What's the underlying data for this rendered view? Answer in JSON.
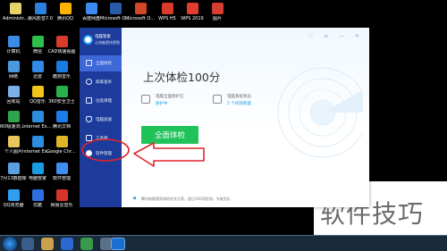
{
  "desktop": {
    "top_icons": [
      {
        "name": "admin-folder-icon",
        "label": "Administr...",
        "color": "#e8d36a"
      },
      {
        "name": "storm-video-icon",
        "label": "暴风影音7.0",
        "color": "#2b80e0"
      },
      {
        "name": "tencent-qq-icon",
        "label": "腾讯QQ",
        "color": "#ffb300"
      },
      {
        "name": "baofeng-icon",
        "label": "百度网盘",
        "color": "#3a8af0"
      },
      {
        "name": "office-word-icon",
        "label": "Microsoft Office Wo...",
        "color": "#2a5aa8"
      },
      {
        "name": "office-ppt-icon",
        "label": "Microsoft Office Po...",
        "color": "#d24726"
      },
      {
        "name": "wps-h5-icon",
        "label": "WPS H5",
        "color": "#d83a2b"
      },
      {
        "name": "wps-2019-icon",
        "label": "WPS 2019",
        "color": "#e23c2d"
      },
      {
        "name": "picture-icon",
        "label": "图片",
        "color": "#d63c2f"
      }
    ],
    "left_icons": [
      {
        "name": "computer-icon",
        "label": "计算机",
        "color": "#3c8be8"
      },
      {
        "name": "network-icon",
        "label": "网络",
        "color": "#4a9ae0"
      },
      {
        "name": "recycle-bin-icon",
        "label": "回收站",
        "color": "#7ab0e8"
      },
      {
        "name": "360-browser-icon",
        "label": "360极速浏览器",
        "color": "#2ea44f"
      },
      {
        "name": "personal-folder-icon",
        "label": "个人图片",
        "color": "#e8c65a"
      },
      {
        "name": "data-icon",
        "label": "7月13数据库",
        "color": "#5aa0e0"
      },
      {
        "name": "qq-browser-icon",
        "label": "QQ浏览器",
        "color": "#2e9ff0"
      }
    ],
    "second_icons": [
      {
        "name": "wechat-icon",
        "label": "微信",
        "color": "#2fbf4a"
      },
      {
        "name": "library-icon",
        "label": "迅雷",
        "color": "#2f8ae8"
      },
      {
        "name": "qq-music-icon",
        "label": "QQ音乐",
        "color": "#f3c51b"
      },
      {
        "name": "ie-icon",
        "label": "Internet Explorer",
        "color": "#2d8be0"
      },
      {
        "name": "ie2-icon",
        "label": "Internet Explorer",
        "color": "#2d8be0"
      },
      {
        "name": "pc-manager-icon",
        "label": "电脑管家",
        "color": "#1a9be6"
      },
      {
        "name": "mihoyo-icon",
        "label": "优酷",
        "color": "#2e6fe0"
      }
    ],
    "third_icons": [
      {
        "name": "cad-icon",
        "label": "CAD快速看图",
        "color": "#d83a2b"
      },
      {
        "name": "kugou-icon",
        "label": "酷狗音乐",
        "color": "#1a7be0"
      },
      {
        "name": "360-safe-icon",
        "label": "360安全卫士",
        "color": "#27b04c"
      },
      {
        "name": "tencent-docs-icon",
        "label": "腾讯文档",
        "color": "#1c7cea"
      },
      {
        "name": "chrome-icon",
        "label": "Google Chrome",
        "color": "#e0b428"
      },
      {
        "name": "software-manager-icon",
        "label": "软件管理",
        "color": "#3f8ff0"
      },
      {
        "name": "netease-icon",
        "label": "网易云音乐",
        "color": "#d8342b"
      }
    ],
    "watermark": "软件技巧"
  },
  "app": {
    "brand_name": "电脑管家",
    "brand_sub": "让电脑更快更稳",
    "nav": [
      {
        "name": "nav-item-checkup",
        "label": "全面体检",
        "active": true
      },
      {
        "name": "nav-item-virus",
        "label": "病毒查杀",
        "active": false
      },
      {
        "name": "nav-item-cleanup",
        "label": "垃圾清理",
        "active": false
      },
      {
        "name": "nav-item-speedup",
        "label": "电脑加速",
        "active": false
      },
      {
        "name": "nav-item-toolbox",
        "label": "工具箱",
        "active": false
      },
      {
        "name": "nav-item-software",
        "label": "软件管理",
        "active": false
      }
    ],
    "titlebar_icons": "♡ ≡ — ✕",
    "headline": "上次体检100分",
    "cards": [
      {
        "title": "电脑全面保护已",
        "status": "防护中"
      },
      {
        "title": "电脑系统状态",
        "status": "5 个权限管理"
      }
    ],
    "scan_button": "全面体检",
    "status_text": "腾讯电脑管家体检优化方案，超过100项检测，节省优化"
  },
  "colors": {
    "sidebar": "#1c3b9a",
    "active_nav": "#3e67d8",
    "accent_green": "#1fc35a",
    "annotation_red": "#e0242a"
  }
}
